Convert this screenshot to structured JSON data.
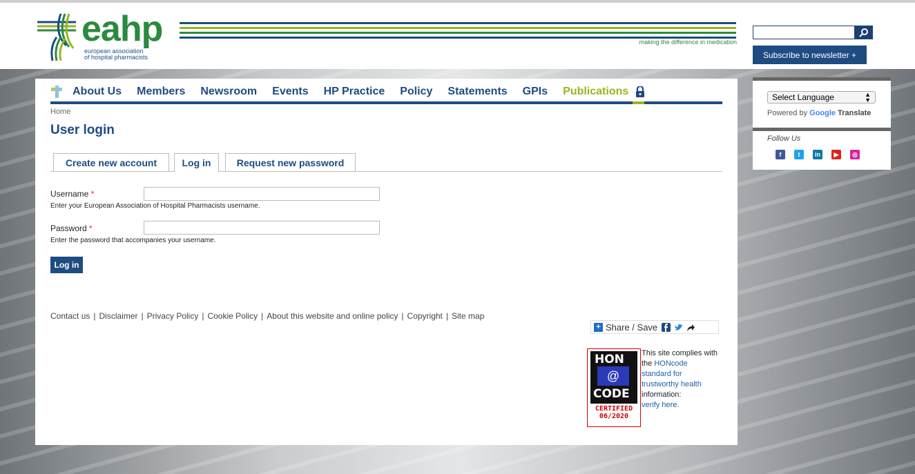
{
  "header": {
    "logo_word": "eahp",
    "logo_sub_line1": "european association",
    "logo_sub_line2": "of hospital pharmacists",
    "tagline": "making the difference in medication",
    "search_placeholder": "",
    "subscribe_label": "Subscribe to newsletter +"
  },
  "nav": {
    "items": [
      "About Us",
      "Members",
      "Newsroom",
      "Events",
      "HP Practice",
      "Policy",
      "Statements",
      "GPIs",
      "Publications"
    ]
  },
  "breadcrumb": "Home",
  "page_title": "User login",
  "tabs": [
    "Create new account",
    "Log in",
    "Request new password"
  ],
  "active_tab": "Log in",
  "form": {
    "username_label": "Username",
    "username_required": "*",
    "username_value": "",
    "username_desc": "Enter your European Association of Hospital Pharmacists username.",
    "password_label": "Password",
    "password_required": "*",
    "password_value": "",
    "password_desc": "Enter the password that accompanies your username.",
    "submit_label": "Log in"
  },
  "footer": {
    "links": [
      "Contact us",
      "Disclaimer",
      "Privacy Policy",
      "Cookie Policy",
      "About this website and online policy",
      "Copyright",
      "Site map"
    ],
    "separator": "|"
  },
  "share": {
    "label": "Share / Save"
  },
  "honcode": {
    "badge_top": "HON",
    "badge_mid": "@",
    "badge_bottom": "CODE",
    "certified": "CERTIFIED",
    "date": "06/2020",
    "text_1": "This site complies with",
    "text_2": "the",
    "link_1": "HONcode",
    "link_2": "standard for",
    "link_3": "trustworthy health",
    "text_3": "information:",
    "link_4": "verify here."
  },
  "sidebar": {
    "language_select": "Select Language",
    "powered_by": "Powered by",
    "google": "Google",
    "translate": "Translate",
    "follow_us": "Follow Us",
    "socials": [
      "facebook-icon",
      "twitter-icon",
      "linkedin-icon",
      "youtube-icon",
      "instagram-icon"
    ]
  },
  "colors": {
    "brand_blue": "#1d4b82",
    "brand_green": "#2b8a3e",
    "accent_lime": "#9ab51f"
  }
}
